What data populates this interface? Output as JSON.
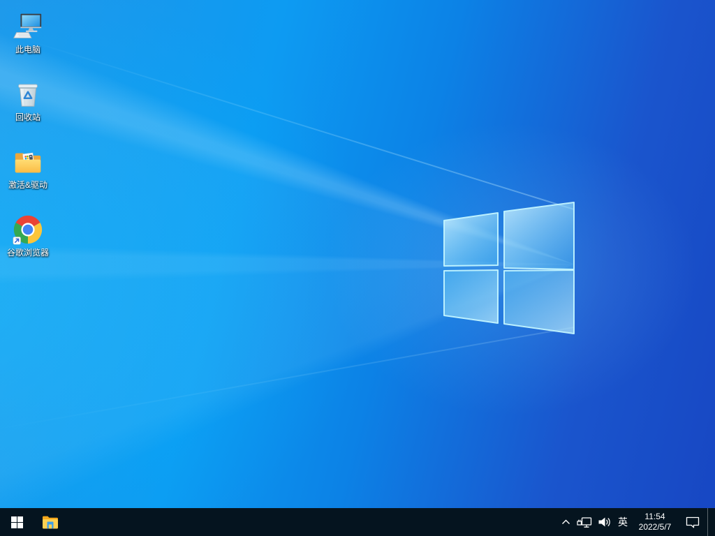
{
  "desktop": {
    "icons": [
      {
        "id": "this-pc",
        "icon": "this-pc-icon",
        "label": "此电脑"
      },
      {
        "id": "recycle-bin",
        "icon": "recycle-bin-icon",
        "label": "回收站"
      },
      {
        "id": "activation-drivers",
        "icon": "folder-icon",
        "label": "激活&驱动"
      },
      {
        "id": "google-chrome",
        "icon": "chrome-icon",
        "label": "谷歌浏览器"
      }
    ],
    "wallpaper": "windows-10-default-light-rays"
  },
  "taskbar": {
    "buttons": [
      {
        "id": "start",
        "icon": "windows-logo-icon"
      },
      {
        "id": "file-explorer",
        "icon": "file-explorer-icon"
      }
    ],
    "tray": {
      "items": [
        {
          "id": "hidden-icons",
          "icon": "chevron-up-icon"
        },
        {
          "id": "network",
          "icon": "network-ethernet-icon"
        },
        {
          "id": "volume",
          "icon": "speaker-icon"
        },
        {
          "id": "ime",
          "label": "英"
        },
        {
          "id": "clock",
          "time": "11:54",
          "date": "2022/5/7"
        },
        {
          "id": "action-center",
          "icon": "action-center-icon"
        },
        {
          "id": "show-desktop"
        }
      ],
      "ime_label": "英",
      "time": "11:54",
      "date": "2022/5/7"
    }
  },
  "colors": {
    "taskbar_bg": "#05141f",
    "wallpaper_bright": "#00a7f6",
    "wallpaper_deep": "#1747c3",
    "logo_border": "#c2f4ff",
    "chrome_red": "#ea4335",
    "chrome_yellow": "#fcc53a",
    "chrome_green": "#34a853",
    "chrome_blue": "#4285f4",
    "folder_yellow": "#ffd152",
    "recycle_arrow_blue": "#2f86d6"
  }
}
